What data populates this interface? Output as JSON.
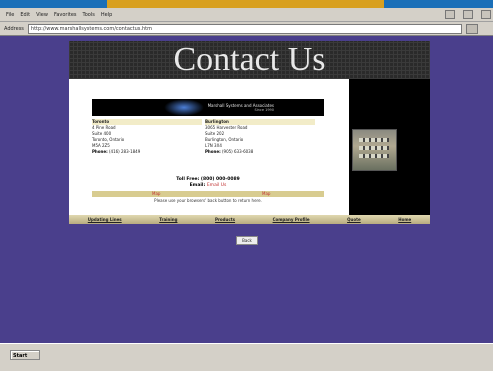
{
  "browser": {
    "menu_items": [
      "File",
      "Edit",
      "View",
      "Favorites",
      "Tools",
      "Help"
    ],
    "address_label": "Address",
    "address_url": "http://www.marshallsystems.com/contactus.htm"
  },
  "page": {
    "header_title": "Contact Us",
    "logo": {
      "company_name": "Marshall Systems and Associates",
      "since": "Since 1990"
    },
    "addresses": [
      {
        "city": "Toronto",
        "lines": [
          "4 Pine Road",
          "Suite 400",
          "Toronto, Ontario",
          "M5A 2Z5"
        ],
        "phone_label": "Phone:",
        "phone": "(416) 283-1849"
      },
      {
        "city": "Burlington",
        "lines": [
          "3065 Harvester Road",
          "Suite 202",
          "Burlington, Ontario",
          "L7N 3X4"
        ],
        "phone_label": "Phone:",
        "phone": "(905) 633-6038"
      }
    ],
    "tollfree": "Toll Free: (800) 000-0089",
    "email_label": "Email:",
    "email_value": "Email Us",
    "map_links": [
      "Map",
      "Map"
    ],
    "back_note": "Please use your browsers' back button to return here.",
    "nav_buttons": [
      "Updating Lines",
      "Training",
      "Products",
      "Company Profile",
      "Quote",
      "Home"
    ],
    "back_button": "Back"
  },
  "taskbar": {
    "start_label": "Start"
  },
  "colors": {
    "page_background": "#4a3f8c",
    "header_background": "#2a2a2a",
    "nav_bar": "#d8cc90",
    "link_red": "#c03030"
  }
}
